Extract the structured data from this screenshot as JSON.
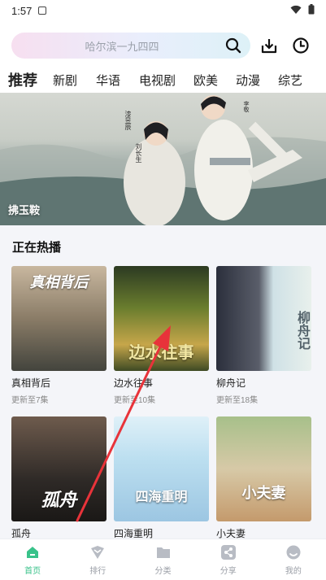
{
  "status_bar": {
    "time": "1:57"
  },
  "search": {
    "placeholder": "哈尔滨一九四四"
  },
  "tabs": [
    {
      "label": "推荐",
      "active": true
    },
    {
      "label": "新剧"
    },
    {
      "label": "华语"
    },
    {
      "label": "电视剧"
    },
    {
      "label": "欧美"
    },
    {
      "label": "动漫"
    },
    {
      "label": "综艺"
    }
  ],
  "banner": {
    "title": "拂玉鞍",
    "credit_left": "漆昱辰",
    "credit_left_role": "刘长生",
    "credit_right": "李敬"
  },
  "section": {
    "title": "正在热播",
    "items": [
      {
        "name": "真相背后",
        "update": "更新至7集",
        "poster_text": "真相背后"
      },
      {
        "name": "边水往事",
        "update": "更新至10集",
        "poster_text": "边水往事"
      },
      {
        "name": "柳舟记",
        "update": "更新至18集",
        "poster_text": "柳舟记"
      },
      {
        "name": "孤舟",
        "update": "",
        "poster_text": "孤舟"
      },
      {
        "name": "四海重明",
        "update": "",
        "poster_text": "四海重明"
      },
      {
        "name": "小夫妻",
        "update": "",
        "poster_text": "小夫妻"
      }
    ]
  },
  "bottom_nav": [
    {
      "label": "首页",
      "icon": "home-icon",
      "active": true
    },
    {
      "label": "排行",
      "icon": "rank-icon"
    },
    {
      "label": "分类",
      "icon": "folder-icon"
    },
    {
      "label": "分享",
      "icon": "share-icon"
    },
    {
      "label": "我的",
      "icon": "profile-icon"
    }
  ],
  "colors": {
    "accent": "#39c28a",
    "tab_dot": "#e0474c",
    "annotation_arrow": "#e8333a"
  }
}
